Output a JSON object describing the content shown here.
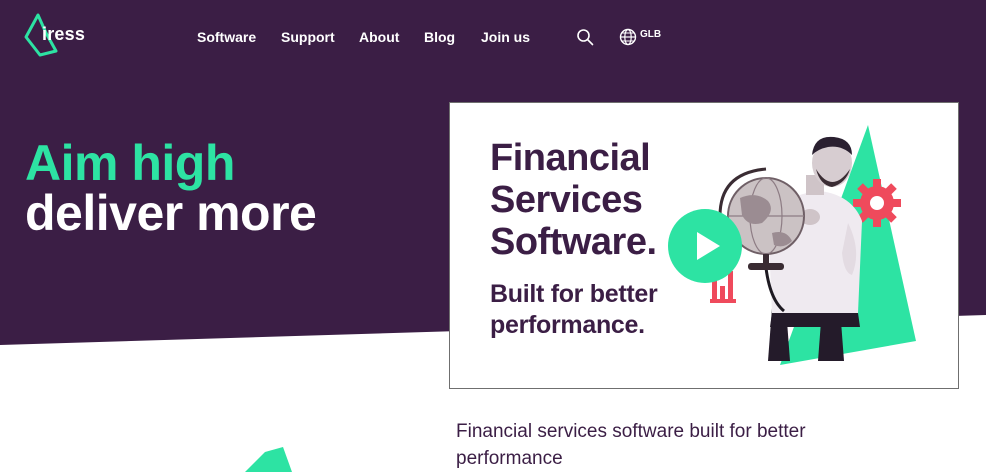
{
  "brand": {
    "name": "iress",
    "accent": "#2de3a3",
    "dark": "#3b1e45",
    "alert": "#ef4a5c"
  },
  "nav": {
    "items": [
      {
        "label": "Software"
      },
      {
        "label": "Support"
      },
      {
        "label": "About"
      },
      {
        "label": "Blog"
      },
      {
        "label": "Join us"
      }
    ],
    "search_icon": "search-icon",
    "region_icon": "globe-icon",
    "region": "GLB"
  },
  "hero": {
    "headline_line1": "Aim high",
    "headline_line2": "deliver more"
  },
  "video": {
    "title_lines": [
      "Financial",
      "Services",
      "Software."
    ],
    "subtitle_lines": [
      "Built for better",
      "performance."
    ],
    "play_icon": "play-icon"
  },
  "description": "Financial services software built for better performance"
}
